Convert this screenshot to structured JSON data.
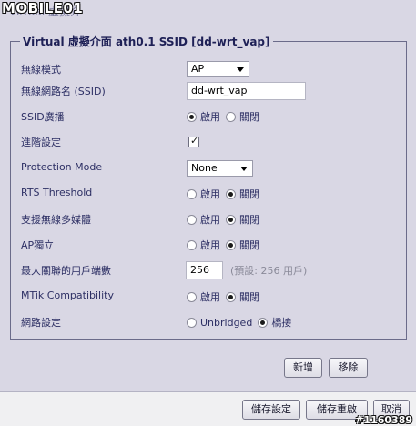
{
  "watermark": "MOBILE01",
  "top_title": "Virtual 虛擬介",
  "panel": {
    "title": "Virtual 虛擬介面 ath0.1 SSID [dd-wrt_vap]"
  },
  "fields": {
    "wireless_mode": {
      "label": "無線模式",
      "value": "AP"
    },
    "ssid": {
      "label": "無線網路名 (SSID)",
      "value": "dd-wrt_vap"
    },
    "ssid_broadcast": {
      "label": "SSID廣播",
      "opt_on": "啟用",
      "opt_off": "關閉",
      "selected": "啟用"
    },
    "advanced": {
      "label": "進階設定",
      "checked": true,
      "tick": "✓"
    },
    "protection_mode": {
      "label": "Protection Mode",
      "value": "None"
    },
    "rts_threshold": {
      "label": "RTS Threshold",
      "opt_on": "啟用",
      "opt_off": "關閉",
      "selected": "關閉"
    },
    "wmm": {
      "label": "支援無線多媒體",
      "opt_on": "啟用",
      "opt_off": "關閉",
      "selected": "關閉"
    },
    "ap_isolation": {
      "label": "AP獨立",
      "opt_on": "啟用",
      "opt_off": "關閉",
      "selected": "關閉"
    },
    "max_clients": {
      "label": "最大關聯的用戶端數",
      "value": "256",
      "hint": "(預設: 256 用戶)"
    },
    "mtik": {
      "label": "MTik Compatibility",
      "opt_on": "啟用",
      "opt_off": "關閉",
      "selected": "關閉"
    },
    "network": {
      "label": "網路設定",
      "opt_a": "Unbridged",
      "opt_b": "橋接",
      "selected": "橋接"
    }
  },
  "buttons": {
    "add": "新增",
    "remove": "移除",
    "save": "儲存設定",
    "save_reboot": "儲存重啟",
    "cancel": "取消"
  },
  "corner_id": "#1160389"
}
